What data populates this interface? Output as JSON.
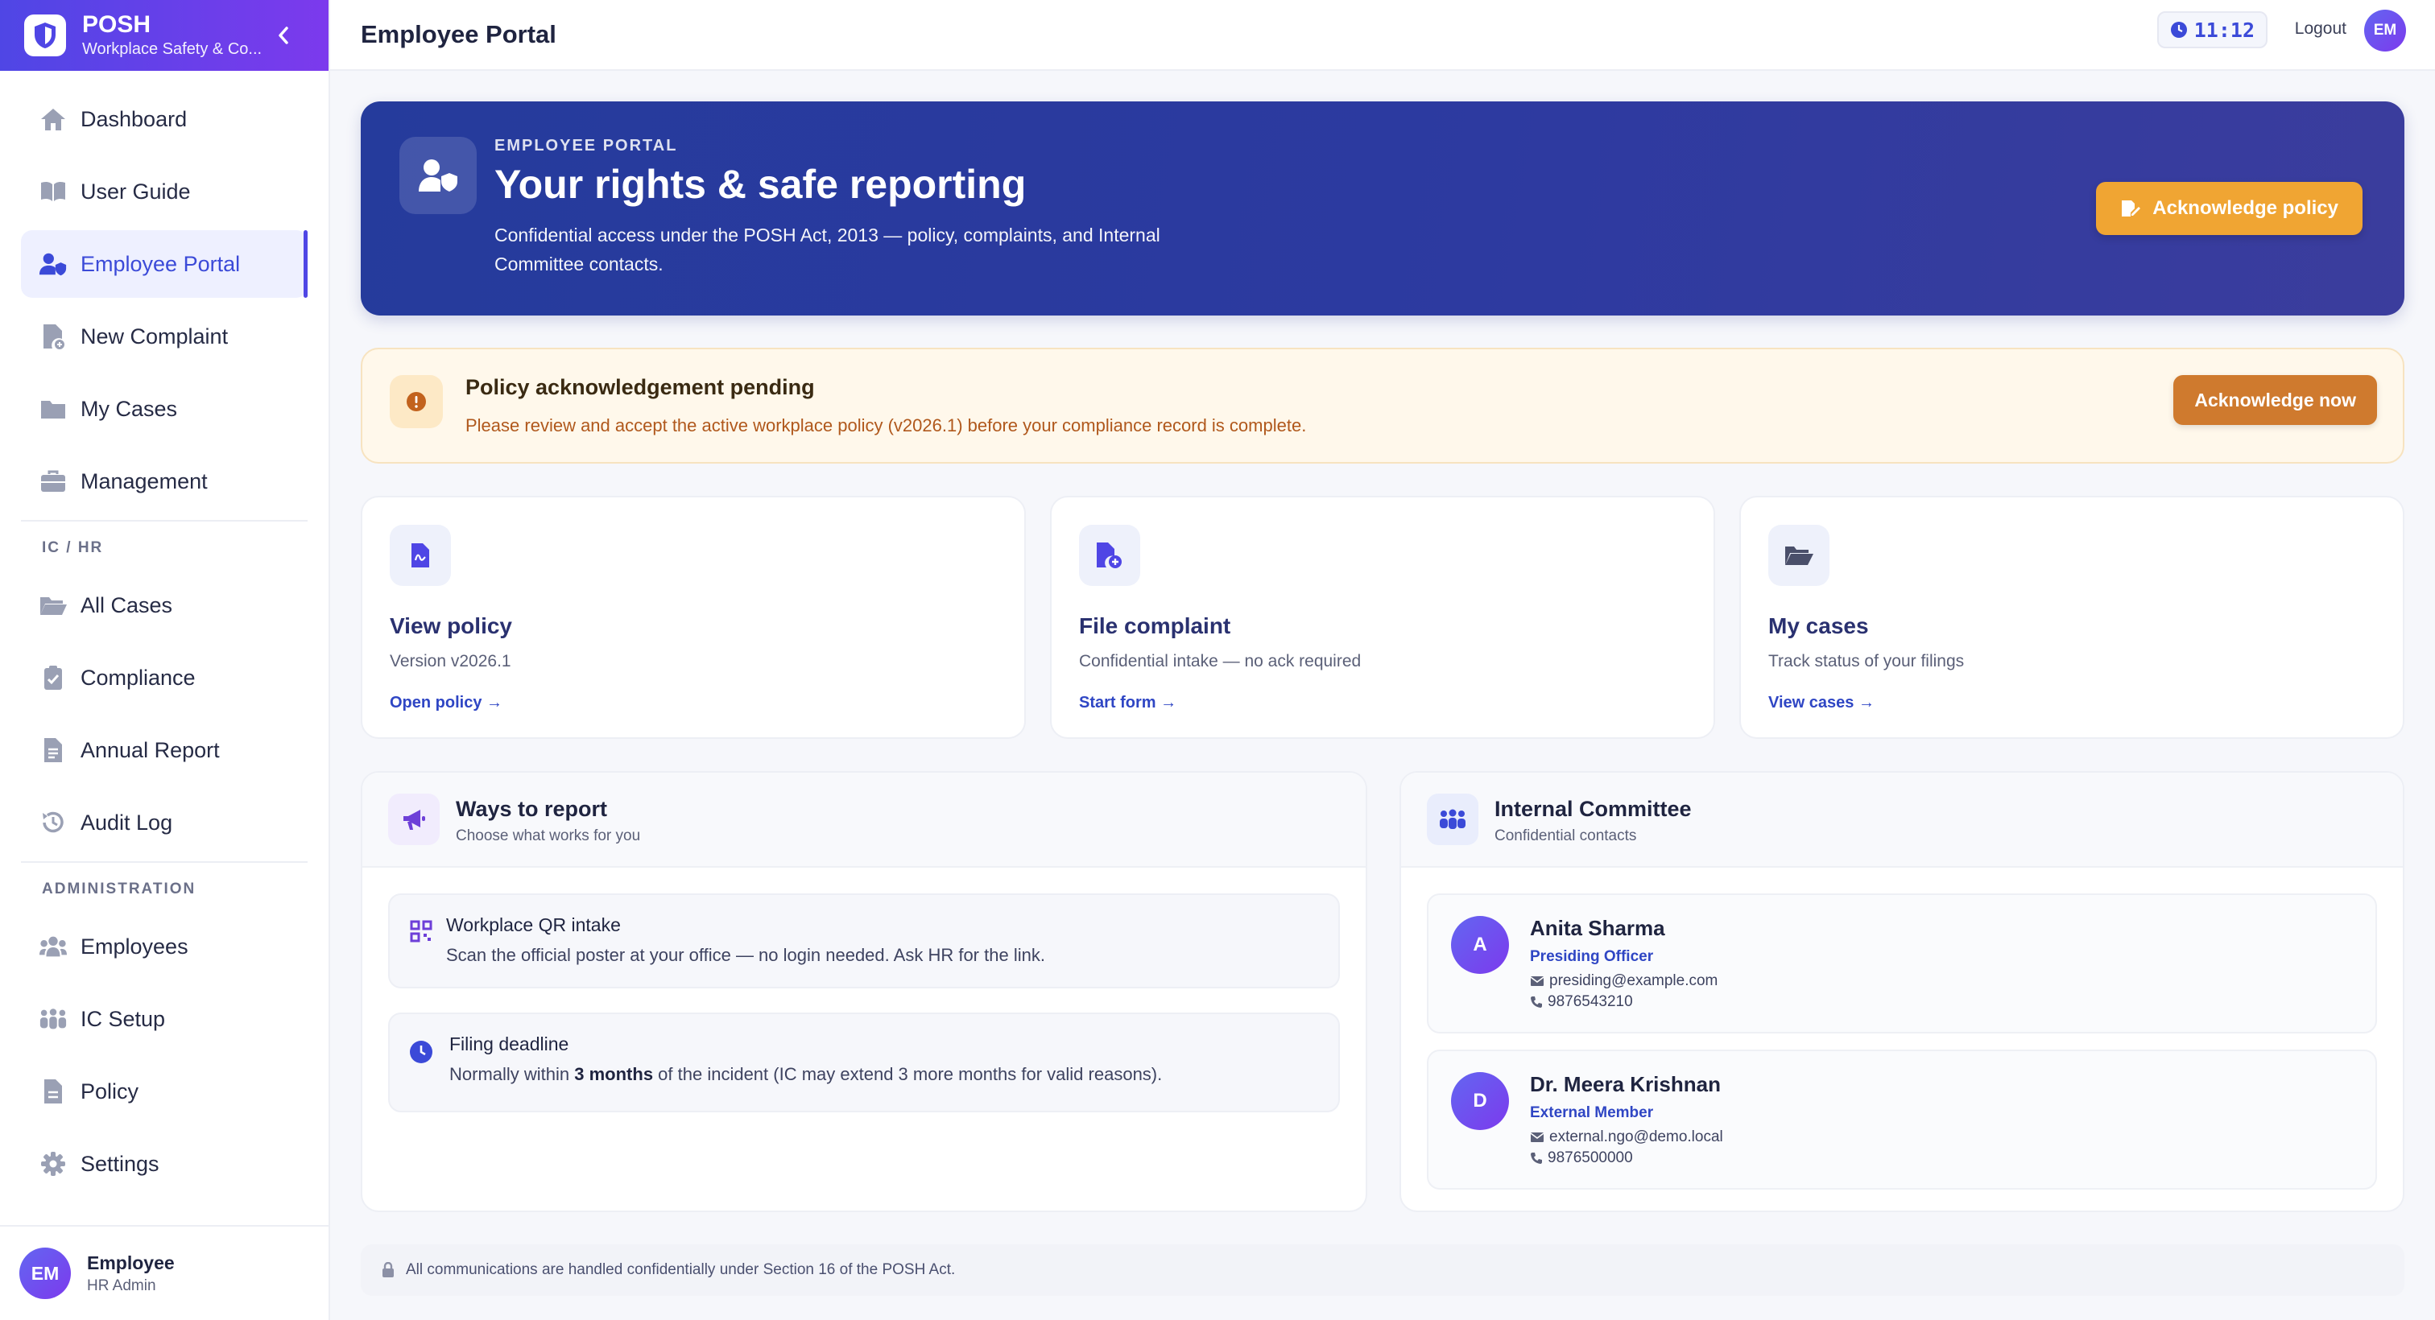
{
  "app": {
    "name": "POSH",
    "subtitle": "Workplace Safety & Co..."
  },
  "sidebar": {
    "primary": [
      {
        "label": "Dashboard",
        "icon": "home-icon"
      },
      {
        "label": "User Guide",
        "icon": "book-icon"
      },
      {
        "label": "Employee Portal",
        "icon": "user-shield-icon",
        "active": true
      },
      {
        "label": "New Complaint",
        "icon": "file-plus-icon"
      },
      {
        "label": "My Cases",
        "icon": "folder-icon"
      },
      {
        "label": "Management",
        "icon": "briefcase-icon"
      }
    ],
    "sections": [
      {
        "label": "IC / HR",
        "items": [
          {
            "label": "All Cases",
            "icon": "folder-open-icon"
          },
          {
            "label": "Compliance",
            "icon": "clipboard-check-icon"
          },
          {
            "label": "Annual Report",
            "icon": "file-text-icon"
          },
          {
            "label": "Audit Log",
            "icon": "history-icon"
          }
        ]
      },
      {
        "label": "ADMINISTRATION",
        "items": [
          {
            "label": "Employees",
            "icon": "users-icon"
          },
          {
            "label": "IC Setup",
            "icon": "people-group-icon"
          },
          {
            "label": "Policy",
            "icon": "file-doc-icon"
          },
          {
            "label": "Settings",
            "icon": "gear-icon"
          }
        ]
      }
    ],
    "user": {
      "initials": "EM",
      "name": "Employee",
      "role": "HR Admin"
    }
  },
  "topbar": {
    "title": "Employee Portal",
    "clock": "11:12",
    "logout": "Logout",
    "avatar": "EM"
  },
  "hero": {
    "eyebrow": "EMPLOYEE PORTAL",
    "title": "Your rights & safe reporting",
    "description": "Confidential access under the POSH Act, 2013 — policy, complaints, and Internal Committee contacts.",
    "button": "Acknowledge policy"
  },
  "alert": {
    "title": "Policy acknowledgement pending",
    "message": "Please review and accept the active workplace policy (v2026.1) before your compliance record is complete.",
    "button": "Acknowledge now"
  },
  "cards": [
    {
      "title": "View policy",
      "subtitle": "Version v2026.1",
      "link": "Open policy →",
      "icon": "policy-doc-icon"
    },
    {
      "title": "File complaint",
      "subtitle": "Confidential intake — no ack required",
      "link": "Start form →",
      "icon": "file-add-icon"
    },
    {
      "title": "My cases",
      "subtitle": "Track status of your filings",
      "link": "View cases →",
      "icon": "folder-open-icon"
    }
  ],
  "ways": {
    "title": "Ways to report",
    "subtitle": "Choose what works for you",
    "items": [
      {
        "title": "Workplace QR intake",
        "text": "Scan the official poster at your office — no login needed. Ask HR for the link.",
        "icon": "qr-icon"
      },
      {
        "title": "Filing deadline",
        "text_before": "Normally within ",
        "text_bold": "3 months",
        "text_after": " of the incident (IC may extend 3 more months for valid reasons).",
        "icon": "clock-icon"
      }
    ]
  },
  "committee": {
    "title": "Internal Committee",
    "subtitle": "Confidential contacts",
    "members": [
      {
        "initial": "A",
        "name": "Anita Sharma",
        "role": "Presiding Officer",
        "email": "presiding@example.com",
        "phone": "9876543210"
      },
      {
        "initial": "D",
        "name": "Dr. Meera Krishnan",
        "role": "External Member",
        "email": "external.ngo@demo.local",
        "phone": "9876500000"
      }
    ]
  },
  "footer": {
    "note": "All communications are handled confidentially under Section 16 of the POSH Act."
  },
  "colors": {
    "brand": "#4f46e5",
    "hero": "#2d3aa0",
    "accent": "#f0a533",
    "alert_button": "#cf7a2e",
    "link": "#2f46c4"
  }
}
